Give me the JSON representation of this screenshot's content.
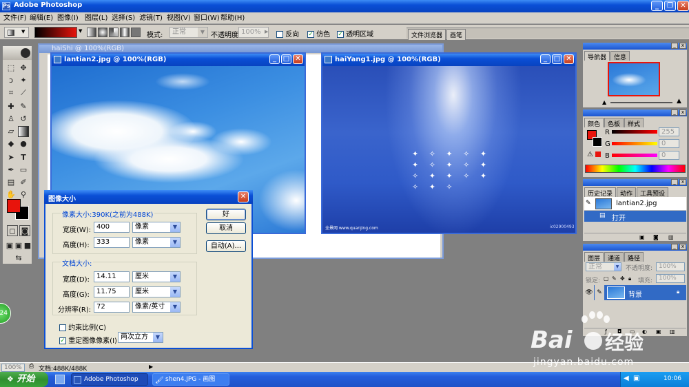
{
  "app": {
    "title": "Adobe Photoshop",
    "window_buttons": {
      "minimize": "_",
      "restore": "❐",
      "close": "✕"
    }
  },
  "menu": [
    "文件(F)",
    "编辑(E)",
    "图像(I)",
    "图层(L)",
    "选择(S)",
    "滤镜(T)",
    "视图(V)",
    "窗口(W)",
    "帮助(H)"
  ],
  "options_bar": {
    "mode_label": "模式:",
    "mode_value": "正常",
    "opacity_label": "不透明度:",
    "opacity_value": "100%",
    "reverse_label": "反向",
    "dither_label": "仿色",
    "transparency_label": "透明区域",
    "reverse_checked": false,
    "dither_checked": true,
    "transparency_checked": true,
    "well_tabs": [
      "文件浏览器",
      "画笔"
    ]
  },
  "documents": {
    "back_title": "haiShi @ 100%(RGB)",
    "lantian_title": "lantian2.jpg @ 100%(RGB)",
    "haiyang_title": "haiYang1.jpg @ 100%(RGB)",
    "haiyang_watermark_left": "全景网  www.quanjing.com",
    "haiyang_watermark_right": "ic02900493"
  },
  "dialog": {
    "title": "图像大小",
    "close": "✕",
    "pixel_group_label": "像素大小:390K(之前为488K)",
    "width_label": "宽度(W):",
    "width_value": "400",
    "width_unit": "像素",
    "height_label": "高度(H):",
    "height_value": "333",
    "height_unit": "像素",
    "doc_group_label": "文档大小:",
    "doc_width_label": "宽度(D):",
    "doc_width_value": "14.11",
    "doc_width_unit": "厘米",
    "doc_height_label": "高度(G):",
    "doc_height_value": "11.75",
    "doc_height_unit": "厘米",
    "resolution_label": "分辨率(R):",
    "resolution_value": "72",
    "resolution_unit": "像素/英寸",
    "constrain_label": "约束比例(C)",
    "constrain_checked": false,
    "resample_label": "重定图像像素(I):",
    "resample_checked": true,
    "resample_method": "两次立方",
    "ok_label": "好",
    "cancel_label": "取消",
    "auto_label": "自动(A)..."
  },
  "navigator_panel": {
    "tabs": [
      "导航器",
      "信息"
    ]
  },
  "color_panel": {
    "tabs": [
      "颜色",
      "色板",
      "样式"
    ],
    "r_label": "R",
    "r_value": "255",
    "g_label": "G",
    "g_value": "0",
    "b_label": "B",
    "b_value": "0"
  },
  "history_panel": {
    "tabs": [
      "历史记录",
      "动作",
      "工具预设"
    ],
    "snapshot_label": "lantian2.jpg",
    "step_label": "打开"
  },
  "layers_panel": {
    "tabs": [
      "图层",
      "通道",
      "路径"
    ],
    "blend_mode": "正常",
    "opacity_label": "不透明度:",
    "opacity_value": "100%",
    "lock_label": "锁定:",
    "fill_label": "填充:",
    "fill_value": "100%",
    "layer_name": "背景"
  },
  "status_bar": {
    "zoom": "100%",
    "doc_info": "文档:488K/488K"
  },
  "taskbar": {
    "start_label": "开始",
    "tasks": [
      "Adobe Photoshop",
      "shen4.JPG - 画图"
    ],
    "clock": "10:06",
    "badge": "24"
  },
  "watermark": {
    "brand": "Bai",
    "brand2": "经验",
    "url": "jingyan.baidu.com"
  },
  "colors": {
    "foreground": "#e8140c",
    "background": "#000000",
    "accent": "#0a4fd6"
  }
}
